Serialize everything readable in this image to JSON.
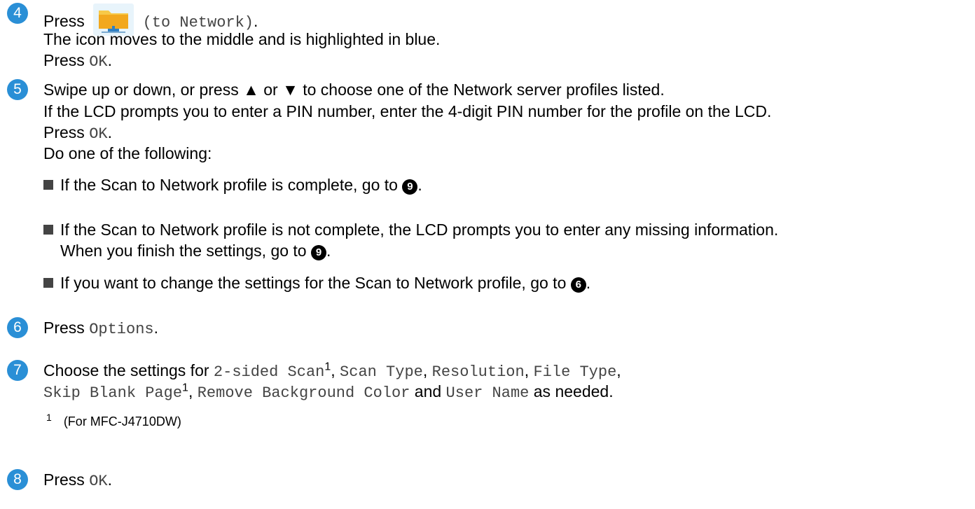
{
  "steps": {
    "s4": {
      "num": "4",
      "press": "Press",
      "to_network": "(to Network)",
      "dot": ".",
      "line2": "The icon moves to the middle and is highlighted in blue.",
      "press2": "Press",
      "ok": "OK",
      "period": "."
    },
    "s5": {
      "num": "5",
      "line1": "Swipe up or down, or press ▲ or ▼ to choose one of the Network server profiles listed.",
      "line2": "If the LCD prompts you to enter a PIN number, enter the 4-digit PIN number for the profile on the LCD.",
      "press": "Press",
      "ok": "OK",
      "period": ".",
      "line4": "Do one of the following:",
      "bullets": {
        "b1": {
          "text": "If the Scan to Network profile is complete, go to",
          "ref": "9"
        },
        "b2": {
          "text": "If the Scan to Network profile is not complete, the LCD prompts you to enter any missing information.",
          "text2": "When you finish the settings, go to",
          "ref": "9"
        },
        "b3": {
          "text": "If you want to change the settings for the Scan to Network profile, go to",
          "ref": "6"
        }
      }
    },
    "s6": {
      "num": "6",
      "press": "Press",
      "options": "Options",
      "period": "."
    },
    "s7": {
      "num": "7",
      "choose": "Choose the settings for",
      "two_sided": "2-sided Scan",
      "sup": "1",
      "scan_type": "Scan Type",
      "resolution": "Resolution",
      "file_type": "File Type",
      "skip_blank": "Skip Blank Page",
      "remove_bg": "Remove Background Color",
      "and": "and",
      "user_name": "User Name",
      "as_needed": "as needed.",
      "comma": ","
    },
    "footnote": {
      "num": "1",
      "text": "(For MFC-J4710DW)"
    },
    "s8": {
      "num": "8",
      "press": "Press",
      "ok": "OK",
      "period": "."
    }
  },
  "icons": {
    "folder": "network-folder-icon",
    "bullet": "square-bullet-icon"
  },
  "colors": {
    "step_badge": "#2a8fd6",
    "folder_top": "#f7c948",
    "folder_body": "#f2a81e",
    "tile": "#e8f4fb"
  }
}
